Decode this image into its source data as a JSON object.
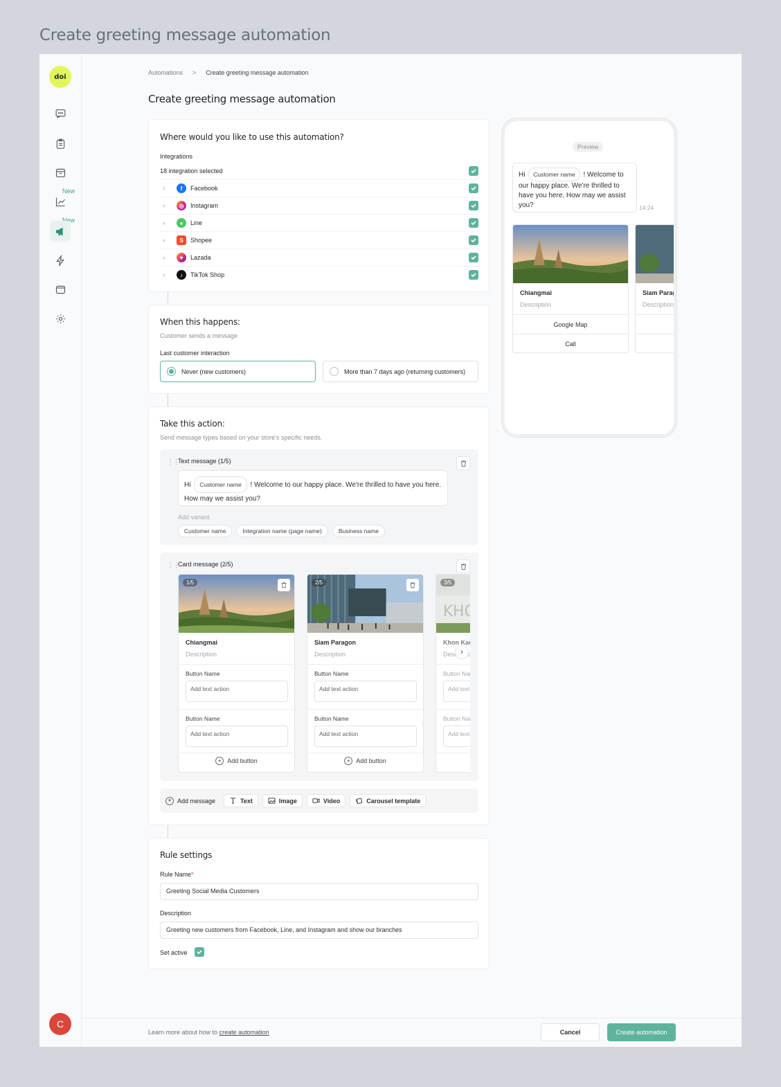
{
  "page": {
    "title": "Create greeting message automation"
  },
  "sidebar": {
    "logo_text": "doi",
    "new_label": "New",
    "avatar_initial": "C"
  },
  "breadcrumb": {
    "parent": "Automations",
    "separator": ">",
    "current": "Create greeting message automation"
  },
  "main_title": "Create greeting message automation",
  "integrations_section": {
    "heading": "Where would you like to use this automation?",
    "label": "Integrations",
    "selected_count": "18 integration selected",
    "items": [
      {
        "name": "Facebook",
        "icon": "facebook-icon",
        "color": "#1877f2"
      },
      {
        "name": "Instagram",
        "icon": "instagram-icon",
        "color": "#d6287c"
      },
      {
        "name": "Line",
        "icon": "line-icon",
        "color": "#4cc764"
      },
      {
        "name": "Shopee",
        "icon": "shopee-icon",
        "color": "#ee4d2d"
      },
      {
        "name": "Lazada",
        "icon": "lazada-icon",
        "color": "#e8367a"
      },
      {
        "name": "TikTok Shop",
        "icon": "tiktok-icon",
        "color": "#111111"
      }
    ]
  },
  "trigger_section": {
    "heading": "When this happens:",
    "subheading": "Customer sends a message",
    "label": "Last customer interaction",
    "options": [
      {
        "label": "Never (new customers)",
        "selected": true
      },
      {
        "label": "More than 7 days ago (returning customers)",
        "selected": false
      }
    ]
  },
  "action_section": {
    "heading": "Take this action:",
    "subheading": "Send message types based on your store's specific needs.",
    "text_message": {
      "label": "Text message (1/5)",
      "greeting": "Hi",
      "variable_chip": "Customer name",
      "body": "!  Welcome to our happy place. We're thrilled to have you here. How may we assist you?",
      "add_variant_label": "Add variant",
      "variants": [
        "Customer name",
        "Integration name (page name)",
        "Business name"
      ]
    },
    "card_message": {
      "label": "Card message (2/5)",
      "button_name_label": "Button Name",
      "button_placeholder": "Add text action",
      "add_button_label": "Add button",
      "cards": [
        {
          "index": "1/5",
          "title": "Chiangmai",
          "description": "Description"
        },
        {
          "index": "2/5",
          "title": "Siam Paragon",
          "description": "Description"
        },
        {
          "index": "3/5",
          "title": "Khon Kaen",
          "description": "Description"
        }
      ]
    },
    "toolbar": {
      "add_message": "Add message",
      "text": "Text",
      "image": "Image",
      "video": "Video",
      "carousel": "Carousel template"
    }
  },
  "rule_section": {
    "heading": "Rule settings",
    "rule_name_label": "Rule Name",
    "required_mark": "*",
    "rule_name_value": "Greeting Social Media Customers",
    "description_label": "Description",
    "description_value": "Greeting new customers from Facebook, Line, and Instagram and show our branches",
    "set_active_label": "Set active",
    "set_active": true
  },
  "preview": {
    "badge": "Preview",
    "greeting": "Hi",
    "variable_chip": "Customer name",
    "body": "!  Welcome to our happy place. We're thrilled to have you here. How may we assist you?",
    "time": "14:24",
    "cards": [
      {
        "title": "Chiangmai",
        "description": "Description",
        "buttons": [
          "Google Map",
          "Call"
        ]
      },
      {
        "title": "Siam Paragon",
        "description": "Description",
        "buttons": [
          "",
          ""
        ]
      }
    ]
  },
  "footer": {
    "learn_prefix": "Learn more about how to ",
    "learn_link": "create automation",
    "cancel": "Cancel",
    "create": "Create automation"
  },
  "colors": {
    "accent": "#5fb39d",
    "logo_bg": "#e2f65c",
    "avatar_bg": "#d9473c"
  }
}
